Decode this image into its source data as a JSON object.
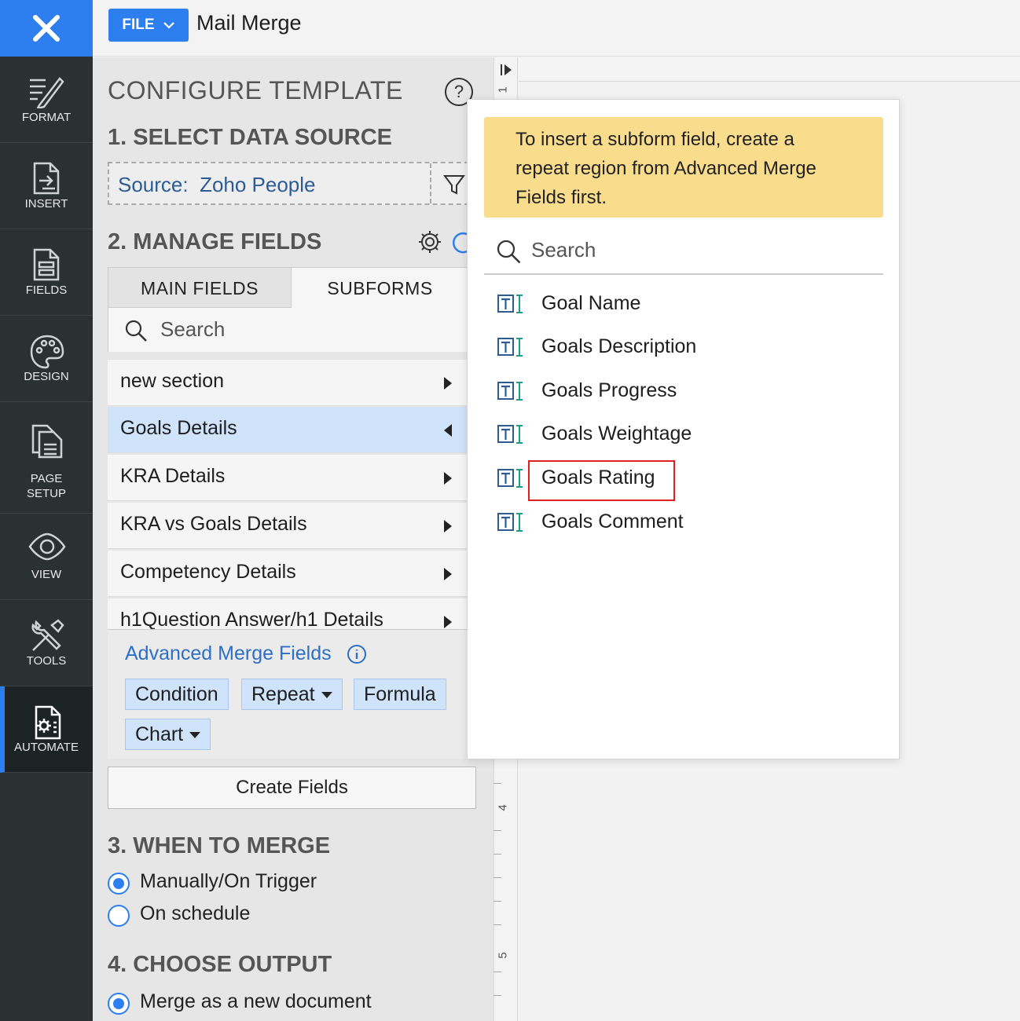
{
  "header": {
    "file_label": "FILE",
    "title": "Mail Merge"
  },
  "rail": {
    "items": [
      {
        "label": "FORMAT"
      },
      {
        "label": "INSERT"
      },
      {
        "label": "FIELDS"
      },
      {
        "label": "DESIGN"
      },
      {
        "label": "PAGE\nSETUP"
      },
      {
        "label": "VIEW"
      },
      {
        "label": "TOOLS"
      },
      {
        "label": "AUTOMATE"
      }
    ]
  },
  "panel": {
    "title": "CONFIGURE TEMPLATE",
    "help": "?",
    "section1": "1. SELECT DATA SOURCE",
    "source_label": "Source:",
    "source_value": "Zoho People",
    "section2": "2. MANAGE FIELDS",
    "tabs": [
      {
        "label": "MAIN FIELDS"
      },
      {
        "label": "SUBFORMS"
      }
    ],
    "search_placeholder": "Search",
    "subforms": [
      {
        "label": "new section"
      },
      {
        "label": "Goals Details"
      },
      {
        "label": "KRA Details"
      },
      {
        "label": "KRA vs Goals Details"
      },
      {
        "label": "Competency Details"
      },
      {
        "label": "h1Question Answer/h1 Details"
      }
    ],
    "advanced_title": "Advanced Merge Fields",
    "advanced_chips": [
      {
        "label": "Condition"
      },
      {
        "label": "Repeat"
      },
      {
        "label": "Formula"
      },
      {
        "label": "Chart"
      }
    ],
    "create_fields": "Create Fields",
    "section3": "3. WHEN TO MERGE",
    "merge_options": [
      {
        "label": "Manually/On Trigger"
      },
      {
        "label": "On schedule"
      }
    ],
    "section4": "4. CHOOSE OUTPUT",
    "output_options": [
      {
        "label": "Merge as a new document"
      }
    ]
  },
  "ruler": {
    "marks": [
      "1",
      "4",
      "5"
    ]
  },
  "popup": {
    "notice": "To insert a subform field, create a repeat region from Advanced Merge Fields first.",
    "search_placeholder": "Search",
    "fields": [
      {
        "label": "Goal Name"
      },
      {
        "label": "Goals Description"
      },
      {
        "label": "Goals Progress"
      },
      {
        "label": "Goals Weightage"
      },
      {
        "label": "Goals Rating"
      },
      {
        "label": "Goals Comment"
      }
    ]
  },
  "colors": {
    "accent": "#2d7ff0",
    "rail_bg": "#2b3033",
    "notice_bg": "#fadd8c",
    "selection_bg": "#cfe3fb",
    "highlight": "#e02020"
  },
  "icons": [
    "close-icon",
    "chevron-down-icon",
    "format-icon",
    "insert-icon",
    "fields-icon",
    "design-icon",
    "page-setup-icon",
    "view-icon",
    "tools-icon",
    "automate-icon",
    "help-icon",
    "filter-icon",
    "gear-icon",
    "refresh-icon",
    "search-icon",
    "info-icon",
    "text-field-icon"
  ]
}
